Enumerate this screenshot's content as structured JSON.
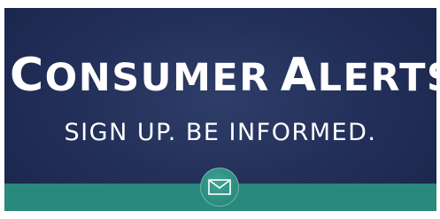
{
  "banner": {
    "title_words": [
      "Consumer",
      "Alerts"
    ],
    "title_words_lower": [
      "ONSUMER",
      "LERTS"
    ],
    "title_initials": [
      "C",
      "A"
    ],
    "tagline": "SIGN UP. BE INFORMED."
  },
  "colors": {
    "background": "#23305a",
    "band": "#28897c",
    "text": "#ffffff"
  },
  "icons": {
    "mail": "envelope-icon"
  }
}
